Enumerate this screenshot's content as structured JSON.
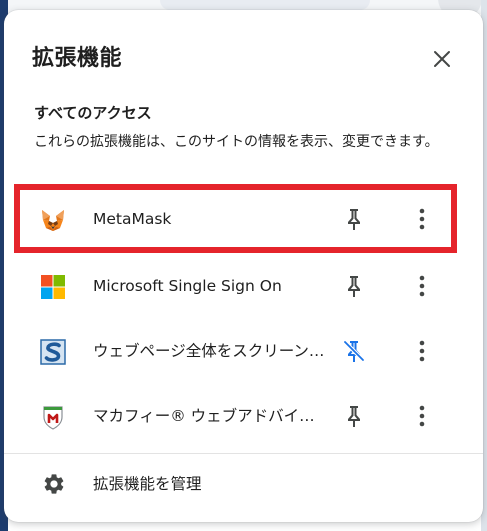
{
  "popup": {
    "title": "拡張機能",
    "close_icon": "close-icon"
  },
  "access_section": {
    "heading": "すべてのアクセス",
    "description": "これらの拡張機能は、このサイトの情報を表示、変更できます。"
  },
  "extensions": [
    {
      "name": "MetaMask",
      "icon": "metamask-fox-icon",
      "pinned": true,
      "highlighted": true
    },
    {
      "name": "Microsoft Single Sign On",
      "icon": "microsoft-logo-icon",
      "pinned": true,
      "highlighted": false
    },
    {
      "name": "ウェブページ全体をスクリーンショット",
      "icon": "screenshot-s-icon",
      "pinned": false,
      "highlighted": false
    },
    {
      "name": "マカフィー® ウェブアドバイザー",
      "icon": "mcafee-shield-icon",
      "pinned": true,
      "highlighted": false
    }
  ],
  "footer": {
    "manage_label": "拡張機能を管理",
    "manage_icon": "gear-icon"
  },
  "colors": {
    "highlight": "#e5242b",
    "pin_active": "#444746",
    "pin_inactive": "#1a73e8",
    "text": "#1f1f1f",
    "divider": "#e3e3e3"
  }
}
